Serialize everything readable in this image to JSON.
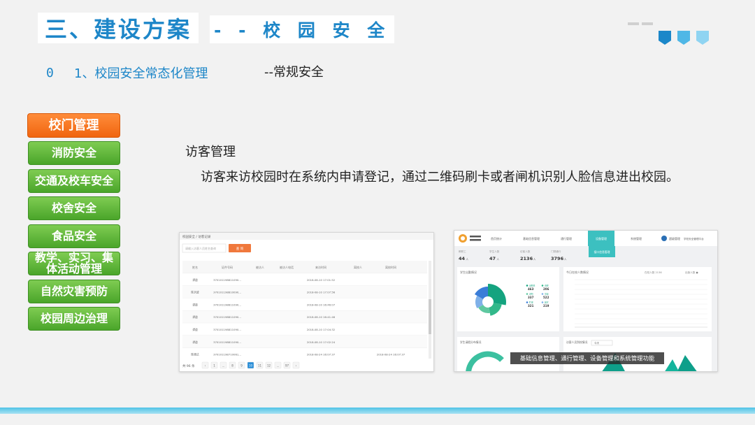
{
  "title": {
    "main": "三、建设方案",
    "sub": "- - 校 园 安 全"
  },
  "colors": {
    "accent": "#1d86c8",
    "menu_green": "#4aa52a",
    "menu_orange": "#f0650f",
    "shield_dark": "#1b87c9",
    "shield_mid": "#4fb7e6",
    "shield_light": "#8fd4f2"
  },
  "subtitle": {
    "bullet": "0",
    "text": "1、校园安全常态化管理",
    "sub": "--常规安全"
  },
  "menu": [
    {
      "label": "校门管理",
      "active": true
    },
    {
      "label": "消防安全"
    },
    {
      "label": "交通及校车安全"
    },
    {
      "label": "校舍安全"
    },
    {
      "label": "食品安全"
    },
    {
      "label": "教学、实习、集体活动管理"
    },
    {
      "label": "自然灾害预防"
    },
    {
      "label": "校园周边治理"
    }
  ],
  "content": {
    "heading": "访客管理",
    "body": "访客来访校园时在系统内申请登记，通过二维码刷卡或者闸机识别人脸信息进出校园。"
  },
  "screenshot_left": {
    "breadcrumb": "校园安全 / 访客记录",
    "search_placeholder": "请输入访客人员姓名查询",
    "search_button": "查 询",
    "columns": [
      "姓名",
      "证件号码",
      "被访人",
      "被访人电话",
      "来访时间",
      "离校人",
      "离校时间"
    ],
    "rows": [
      [
        "谭道",
        "370101198811090...",
        "",
        "",
        "2018-08-10 17:01:52",
        "",
        ""
      ],
      [
        "陈洪波",
        "370101198810090...",
        "",
        "",
        "2018-08-10 17:07:56",
        "",
        ""
      ],
      [
        "谭道",
        "370101198811090...",
        "",
        "",
        "2018-08-10 16:46:07",
        "",
        ""
      ],
      [
        "谭道",
        "370101198811090...",
        "",
        "",
        "2018-08-10 16:41:46",
        "",
        ""
      ],
      [
        "谭道",
        "370101198811090...",
        "",
        "",
        "2018-08-10 17:04:32",
        "",
        ""
      ],
      [
        "谭道",
        "370101198811090...",
        "",
        "",
        "2018-08-10 17:02:24",
        "",
        ""
      ],
      [
        "陈德达",
        "370101198710061...",
        "",
        "",
        "2018-08-24 16:07:37",
        "",
        "2018-08-24 16:07:37"
      ]
    ],
    "pager_total": "共 96 条",
    "pages": [
      "‹",
      "1",
      "...",
      "8",
      "9",
      "10",
      "11",
      "12",
      "...",
      "97",
      "›"
    ],
    "pager_active_index": 5
  },
  "screenshot_right": {
    "nav_tabs": [
      "首页统计",
      "基础信息管理",
      "通行管理",
      "设备管理",
      "系统管理"
    ],
    "nav_active_index": 3,
    "nav_sub": "接口信息管理",
    "user": "超级管理",
    "nav_right": "学校安全管理平台",
    "stats": [
      {
        "label": "教职工",
        "value": "44",
        "unit": "人"
      },
      {
        "label": "学生人数",
        "value": "47",
        "unit": "人"
      },
      {
        "label": "访客人数",
        "value": "2136",
        "unit": "人"
      },
      {
        "label": "门禁通行",
        "value": "3796",
        "unit": "人"
      }
    ],
    "panel_left_title": "学生出勤情况",
    "panel_right_title": "今日在校人数情况",
    "panel_right_info_a": "在校人数 2136",
    "panel_right_info_b": "出勤人数 ●",
    "bottom_left_title": "学生请假分布情况",
    "bottom_right_title": "访客人员到校情况",
    "bottom_right_select": "今天",
    "legend": [
      {
        "name": "出勤率",
        "value": "463"
      },
      {
        "name": "请假",
        "value": "206"
      },
      {
        "name": "迟到",
        "value": "337"
      },
      {
        "name": "早退",
        "value": "522"
      },
      {
        "name": "旷课",
        "value": "321"
      },
      {
        "name": "其它",
        "value": "219"
      }
    ],
    "caption": "基础信息管理、通行管理、设备管理和系统管理功能"
  }
}
